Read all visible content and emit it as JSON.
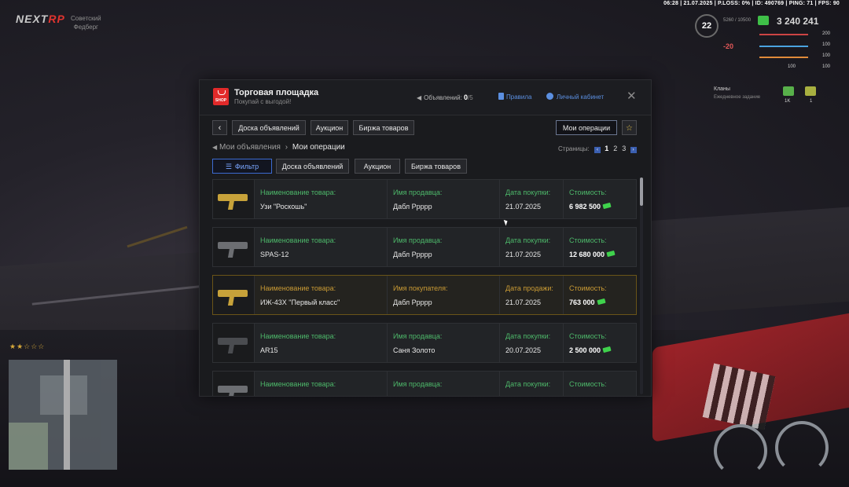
{
  "hud": {
    "topbar": "06:28 | 21.07.2025 | P.LOSS: 0% | ID: 490769 | PING: 71 | FPS: 90",
    "logo_a": "NEXT",
    "logo_b": "RP",
    "district_1": "Советский",
    "district_2": "Федберг",
    "level": "22",
    "xp": "5260 / 10500",
    "money": "3 240 241",
    "health": "-20",
    "stat_1": "200",
    "stat_2": "100",
    "stat_3": "100",
    "stat_4": "100",
    "stat_5": "100",
    "clans": "Кланы",
    "clans_sub": "Ежедневное задание",
    "clan_1": "1K",
    "clan_2": "1",
    "stars": "★★☆☆☆"
  },
  "panel": {
    "title": "Торговая площадка",
    "subtitle": "Покупай с выгодой!",
    "shop_label": "SHOP",
    "ads_label": "Объявлений:",
    "ads_count": "0",
    "ads_limit": "/5",
    "rules": "Правила",
    "cabinet": "Личный кабинет",
    "close": "✕"
  },
  "nav": {
    "back": "‹",
    "tab_board": "Доска объявлений",
    "tab_auction": "Аукцион",
    "tab_exchange": "Биржа товаров",
    "my_ops": "Мои операции",
    "favorite": "☆"
  },
  "breadcrumb": {
    "root": "Мои объявления",
    "sep": "›",
    "current": "Мои операции"
  },
  "pagination": {
    "label": "Страницы:",
    "prev": "‹",
    "next": "›",
    "pages": [
      "1",
      "2",
      "3"
    ],
    "current": 1
  },
  "filters": {
    "filter": "Фильтр",
    "board": "Доска объявлений",
    "auction": "Аукцион",
    "exchange": "Биржа товаров"
  },
  "operations": [
    {
      "kind": "purchase",
      "name_label": "Наименование товара:",
      "name": "Узи \"Роскошь\"",
      "party_label": "Имя продавца:",
      "party": "Дабл Ррррр",
      "date_label": "Дата покупки:",
      "date": "21.07.2025",
      "price_label": "Стоимость:",
      "price": "6 982 500",
      "gun": "gold"
    },
    {
      "kind": "purchase",
      "name_label": "Наименование товара:",
      "name": "SPAS-12",
      "party_label": "Имя продавца:",
      "party": "Дабл Ррррр",
      "date_label": "Дата покупки:",
      "date": "21.07.2025",
      "price_label": "Стоимость:",
      "price": "12 680 000",
      "gun": "grey"
    },
    {
      "kind": "sale",
      "name_label": "Наименование товара:",
      "name": "ИЖ-43Х \"Первый класс\"",
      "party_label": "Имя покупателя:",
      "party": "Дабл Ррррр",
      "date_label": "Дата продажи:",
      "date": "21.07.2025",
      "price_label": "Стоимость:",
      "price": "763 000",
      "gun": "gold"
    },
    {
      "kind": "purchase",
      "name_label": "Наименование товара:",
      "name": "AR15",
      "party_label": "Имя продавца:",
      "party": "Саня Золото",
      "date_label": "Дата покупки:",
      "date": "20.07.2025",
      "price_label": "Стоимость:",
      "price": "2 500 000",
      "gun": "dark"
    },
    {
      "kind": "purchase",
      "name_label": "Наименование товара:",
      "name": "",
      "party_label": "Имя продавца:",
      "party": "",
      "date_label": "Дата покупки:",
      "date": "",
      "price_label": "Стоимость:",
      "price": "",
      "gun": "grey"
    }
  ],
  "colors": {
    "accent_green": "#4db86a",
    "accent_gold": "#c99a34",
    "link_blue": "#5b8fe0",
    "shop_red": "#e22a2a"
  }
}
